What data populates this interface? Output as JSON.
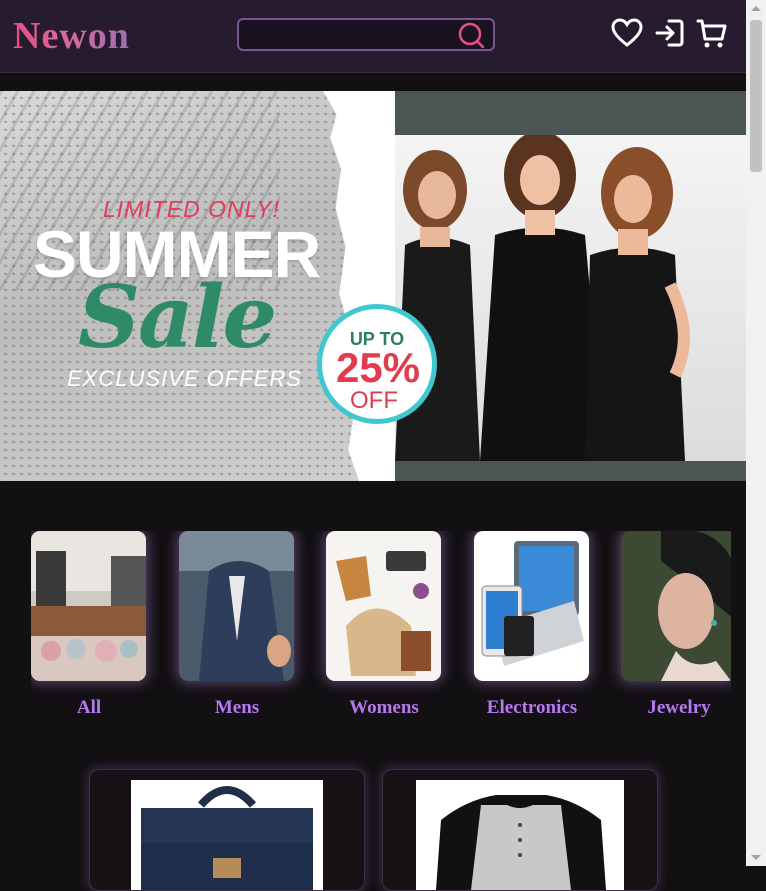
{
  "header": {
    "logo": "Newon",
    "search": {
      "value": "",
      "placeholder": ""
    },
    "icons": [
      "wishlist-heart-icon",
      "login-icon",
      "cart-icon"
    ]
  },
  "banner": {
    "limited": "LIMITED ONLY!",
    "summer": "SUMMER",
    "sale": "Sale",
    "exclusive": "EXCLUSIVE OFFERS",
    "badge": {
      "upto": "UP TO",
      "percent": "25%",
      "off": "OFF"
    }
  },
  "categories": [
    {
      "label": "All"
    },
    {
      "label": "Mens"
    },
    {
      "label": "Womens"
    },
    {
      "label": "Electronics"
    },
    {
      "label": "Jewelry"
    }
  ],
  "colors": {
    "accent": "#b679f4",
    "header_bg": "#271c2f",
    "page_bg": "#121012",
    "logo_pink": "#e34f85"
  }
}
